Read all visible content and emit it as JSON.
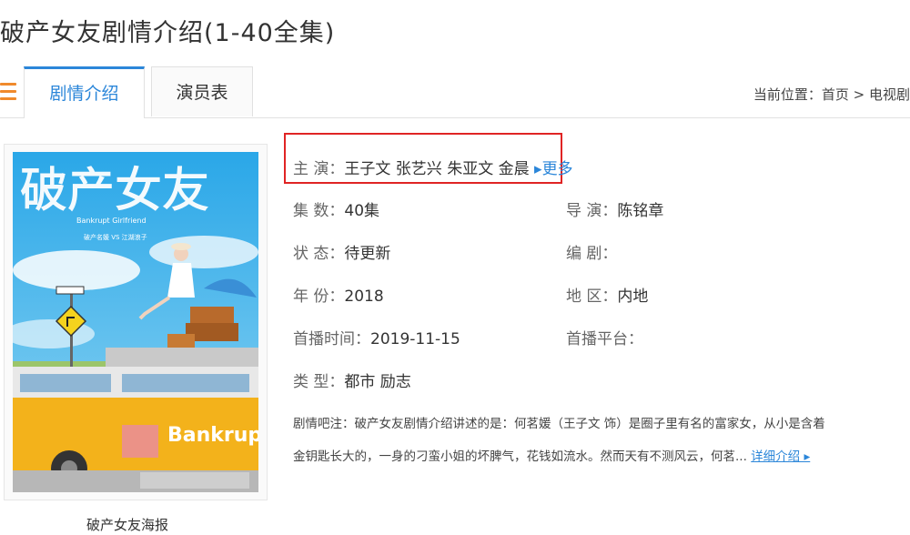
{
  "page": {
    "title": "破产女友剧情介绍(1-40全集)"
  },
  "tabs": [
    {
      "label": "剧情介绍",
      "active": true
    },
    {
      "label": "演员表",
      "active": false
    }
  ],
  "breadcrumb": {
    "prefix": "当前位置：",
    "home": "首页",
    "sep": " > ",
    "current": "电视剧"
  },
  "poster": {
    "caption": "破产女友海报",
    "title_art": "破产女友",
    "subtitle_en": "Bankrupt Girlfriend",
    "tagline": "破产名媛 VS 江湖浪子",
    "van_text": "Bankrup"
  },
  "info": {
    "cast_label": "主 演：",
    "cast": "王子文 张艺兴 朱亚文 金晨",
    "more": "更多",
    "episodes_label": "集 数：",
    "episodes": "40集",
    "director_label": "导 演：",
    "director": "陈铭章",
    "status_label": "状 态：",
    "status": "待更新",
    "writer_label": "编 剧：",
    "writer": "",
    "year_label": "年 份：",
    "year": "2018",
    "region_label": "地 区：",
    "region": "内地",
    "premiere_label": "首播时间：",
    "premiere": "2019-11-15",
    "platform_label": "首播平台：",
    "platform": "",
    "genre_label": "类 型：",
    "genre": "都市 励志"
  },
  "synopsis": {
    "line1": "剧情吧注：破产女友剧情介绍讲述的是：何茗媛（王子文 饰）是圈子里有名的富家女，从小是含着",
    "line2": "金钥匙长大的，一身的刁蛮小姐的坏脾气，花钱如流水。然而天有不测风云，何茗...",
    "detail_link": "详细介绍 ▸"
  },
  "colors": {
    "accent": "#2b86d9",
    "highlight": "#e02424",
    "menu": "#f08a2c"
  }
}
